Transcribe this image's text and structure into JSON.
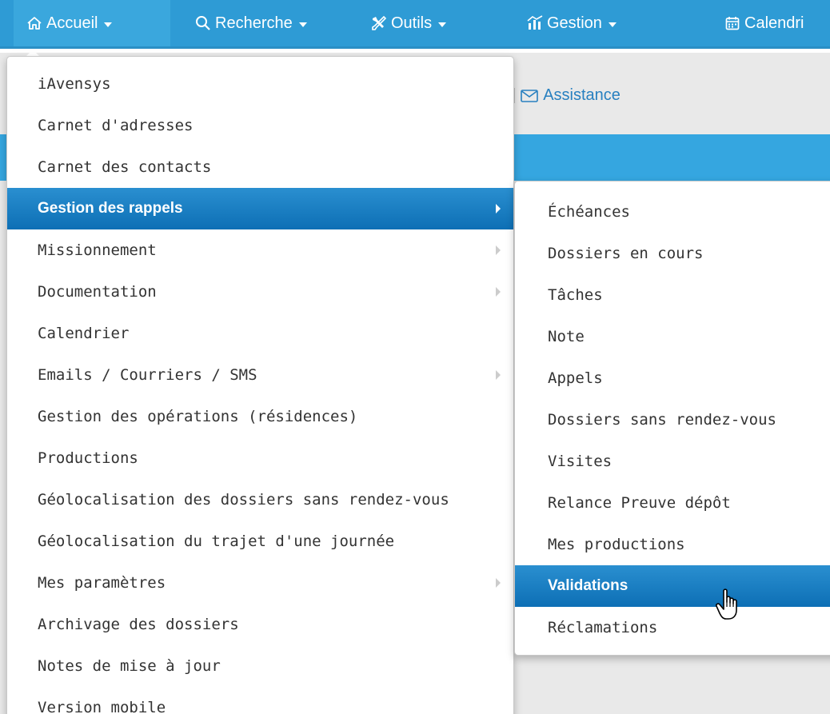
{
  "navbar": {
    "items": [
      {
        "label": "Accueil",
        "icon": "home-icon"
      },
      {
        "label": "Recherche",
        "icon": "search-icon"
      },
      {
        "label": "Outils",
        "icon": "tools-icon"
      },
      {
        "label": "Gestion",
        "icon": "chart-icon"
      },
      {
        "label": "Calendri",
        "icon": "calendar-icon"
      }
    ],
    "colors": {
      "bar": "#2e9bd5",
      "active": "#3aa7dd"
    }
  },
  "page": {
    "assistance_sep": "|",
    "assistance_label": "Assistance",
    "assistance_icon": "envelope-icon"
  },
  "main_menu": {
    "items": [
      {
        "label": "iAvensys",
        "submenu": false
      },
      {
        "label": "Carnet d'adresses",
        "submenu": false
      },
      {
        "label": "Carnet des contacts",
        "submenu": false
      },
      {
        "label": "Gestion des rappels",
        "submenu": true,
        "active": true
      },
      {
        "label": "Missionnement",
        "submenu": true
      },
      {
        "label": "Documentation",
        "submenu": true
      },
      {
        "label": "Calendrier",
        "submenu": false
      },
      {
        "label": "Emails / Courriers / SMS",
        "submenu": true
      },
      {
        "label": "Gestion des opérations (résidences)",
        "submenu": false
      },
      {
        "label": "Productions",
        "submenu": false
      },
      {
        "label": "Géolocalisation des dossiers sans rendez-vous",
        "submenu": false
      },
      {
        "label": "Géolocalisation du trajet d'une journée",
        "submenu": false
      },
      {
        "label": "Mes paramètres",
        "submenu": true
      },
      {
        "label": "Archivage des dossiers",
        "submenu": false
      },
      {
        "label": "Notes de mise à jour",
        "submenu": false
      },
      {
        "label": "Version mobile",
        "submenu": false
      }
    ]
  },
  "sub_menu": {
    "items": [
      {
        "label": "Échéances"
      },
      {
        "label": "Dossiers en cours"
      },
      {
        "label": "Tâches"
      },
      {
        "label": "Note"
      },
      {
        "label": "Appels"
      },
      {
        "label": "Dossiers sans rendez-vous"
      },
      {
        "label": "Visites"
      },
      {
        "label": "Relance Preuve dépôt"
      },
      {
        "label": "Mes productions"
      },
      {
        "label": "Validations",
        "active": true
      },
      {
        "label": "Réclamations"
      }
    ]
  },
  "accent_color": "#1a7fc4"
}
